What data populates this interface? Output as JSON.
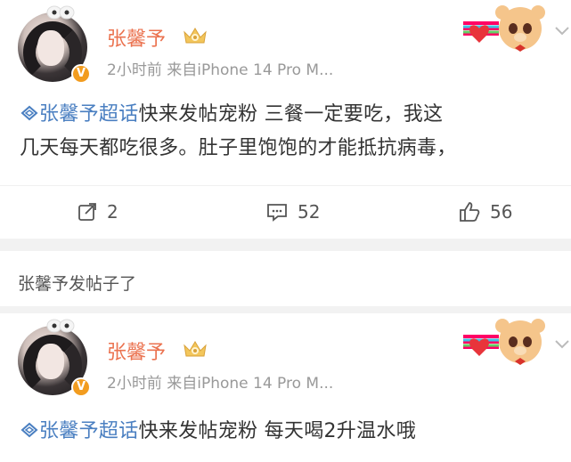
{
  "posts": [
    {
      "username": "张馨予",
      "meta": "2小时前  来自iPhone 14 Pro M...",
      "topic": "张馨予超话",
      "line1": "快来发帖宠粉 三餐一定要吃，我这",
      "line2": "几天每天都吃很多。肚子里饱饱的才能抵抗病毒，",
      "actions": {
        "share": "2",
        "comment": "52",
        "like": "56"
      }
    },
    {
      "username": "张馨予",
      "meta": "2小时前  来自iPhone 14 Pro M...",
      "topic": "张馨予超话",
      "line1": "快来发帖宠粉 每天喝2升温水哦"
    }
  ],
  "notice": "张馨予发帖子了",
  "colors": {
    "username": "#eb7350",
    "topic": "#4a7fc1",
    "meta": "#999999",
    "divider": "#f2f2f2"
  },
  "icons": [
    "v-badge-icon",
    "crown-badge-icon",
    "bear-sticker-icon",
    "chevron-down-icon",
    "super-topic-icon",
    "share-icon",
    "comment-icon",
    "like-icon"
  ]
}
